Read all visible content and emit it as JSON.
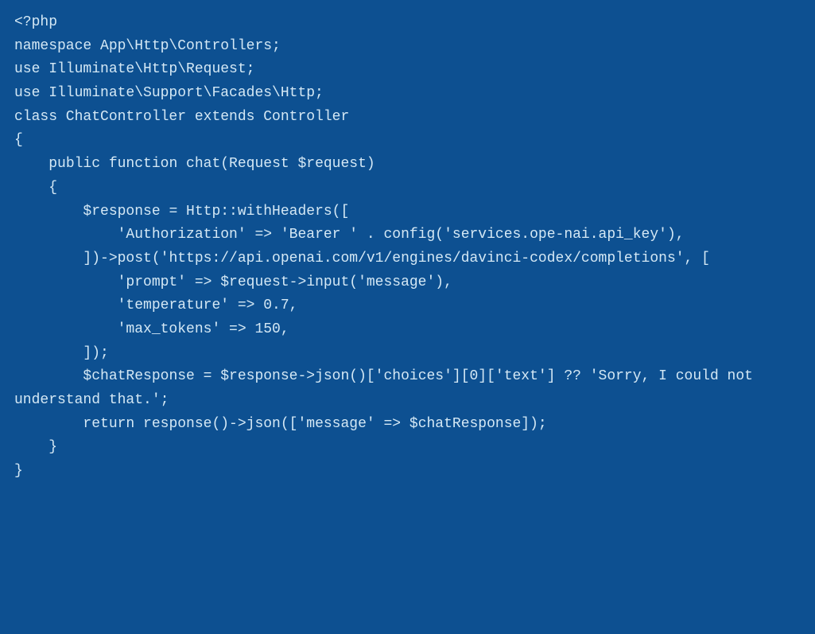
{
  "code": {
    "lines": [
      "<?php",
      "namespace App\\Http\\Controllers;",
      "use Illuminate\\Http\\Request;",
      "use Illuminate\\Support\\Facades\\Http;",
      "class ChatController extends Controller",
      "{",
      "    public function chat(Request $request)",
      "    {",
      "        $response = Http::withHeaders([",
      "            'Authorization' => 'Bearer ' . config('services.ope-nai.api_key'),",
      "        ])->post('https://api.openai.com/v1/engines/davinci-codex/completions', [",
      "            'prompt' => $request->input('message'),",
      "            'temperature' => 0.7,",
      "            'max_tokens' => 150,",
      "        ]);",
      "        $chatResponse = $response->json()['choices'][0]['text'] ?? 'Sorry, I could not understand that.';",
      "        return response()->json(['message' => $chatResponse]);",
      "    }",
      "}"
    ]
  }
}
